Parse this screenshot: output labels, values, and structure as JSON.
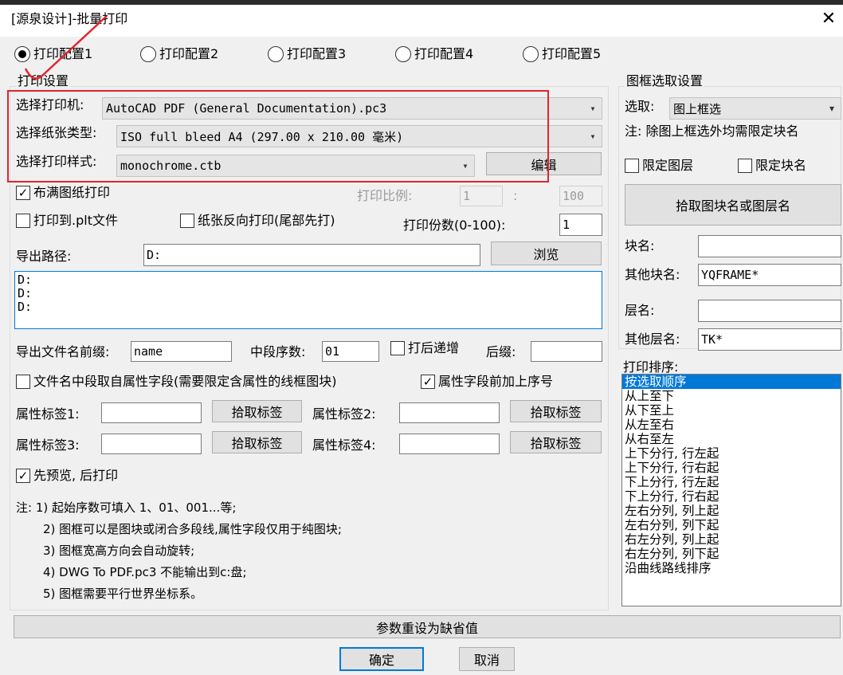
{
  "window": {
    "title": "[源泉设计]-批量打印",
    "close_icon": "close-icon"
  },
  "configs": [
    {
      "label": "打印配置1",
      "selected": true
    },
    {
      "label": "打印配置2",
      "selected": false
    },
    {
      "label": "打印配置3",
      "selected": false
    },
    {
      "label": "打印配置4",
      "selected": false
    },
    {
      "label": "打印配置5",
      "selected": false
    }
  ],
  "print_settings": {
    "group_title": "打印设置",
    "printer_label": "选择打印机:",
    "printer_value": "AutoCAD PDF (General Documentation).pc3",
    "paper_label": "选择纸张类型:",
    "paper_value": "ISO full bleed A4 (297.00 x 210.00 毫米)",
    "style_label": "选择打印样式:",
    "style_value": "monochrome.ctb",
    "edit_button": "编辑",
    "fit_paper_label": "布满图纸打印",
    "fit_paper_checked": true,
    "scale_label": "打印比例:",
    "scale_left": "1",
    "scale_sep": ":",
    "scale_right": "100",
    "plot_file_label": "打印到.plt文件",
    "plot_file_checked": false,
    "reverse_label": "纸张反向打印(尾部先打)",
    "reverse_checked": false,
    "copies_label": "打印份数(0-100):",
    "copies_value": "1",
    "export_path_label": "导出路径:",
    "export_path_value": "D:",
    "browse_button": "浏览",
    "path_list": [
      "D:",
      "D:",
      "D:"
    ],
    "prefix_label": "导出文件名前缀:",
    "prefix_value": "name",
    "mid_seq_label": "中段序数:",
    "mid_seq_value": "01",
    "increment_label": "打后递增",
    "increment_checked": false,
    "suffix_label": "后缀:",
    "suffix_value": "",
    "attr_mid_label": "文件名中段取自属性字段(需要限定含属性的线框图块)",
    "attr_mid_checked": false,
    "attr_prefix_label": "属性字段前加上序号",
    "attr_prefix_checked": true,
    "tag1_label": "属性标签1:",
    "tag2_label": "属性标签2:",
    "tag3_label": "属性标签3:",
    "tag4_label": "属性标签4:",
    "pick_tag_button": "拾取标签",
    "preview_label": "先预览, 后打印",
    "preview_checked": true,
    "notes": [
      "注: 1) 起始序数可填入 1、01、001...等;",
      "2) 图框可以是图块或闭合多段线,属性字段仅用于纯图块;",
      "3) 图框宽高方向会自动旋转;",
      "4) DWG To PDF.pc3 不能输出到c:盘;",
      "5) 图框需要平行世界坐标系。"
    ]
  },
  "frame_select": {
    "group_title": "图框选取设置",
    "select_label": "选取:",
    "select_value": "图上框选",
    "note": "注: 除图上框选外均需限定块名",
    "limit_layer_label": "限定图层",
    "limit_layer_checked": false,
    "limit_block_label": "限定块名",
    "limit_block_checked": false,
    "pick_button": "拾取图块名或图层名",
    "block_name_label": "块名:",
    "block_name_value": "",
    "other_block_label": "其他块名:",
    "other_block_value": "YQFRAME*",
    "layer_name_label": "层名:",
    "layer_name_value": "",
    "other_layer_label": "其他层名:",
    "other_layer_value": "TK*"
  },
  "print_order": {
    "label": "打印排序:",
    "items": [
      "按选取顺序",
      "从上至下",
      "从下至上",
      "从左至右",
      "从右至左",
      "上下分行, 行左起",
      "上下分行, 行右起",
      "下上分行, 行左起",
      "下上分行, 行右起",
      "左右分列, 列上起",
      "左右分列, 列下起",
      "右左分列, 列上起",
      "右左分列, 列下起",
      "沿曲线路线排序"
    ],
    "selected_index": 0
  },
  "footer": {
    "reset_button": "参数重设为缺省值",
    "ok_button": "确定",
    "cancel_button": "取消"
  },
  "colors": {
    "accent": "#0078d7",
    "highlight_box": "#e0252e",
    "background": "#f0f0f0"
  }
}
